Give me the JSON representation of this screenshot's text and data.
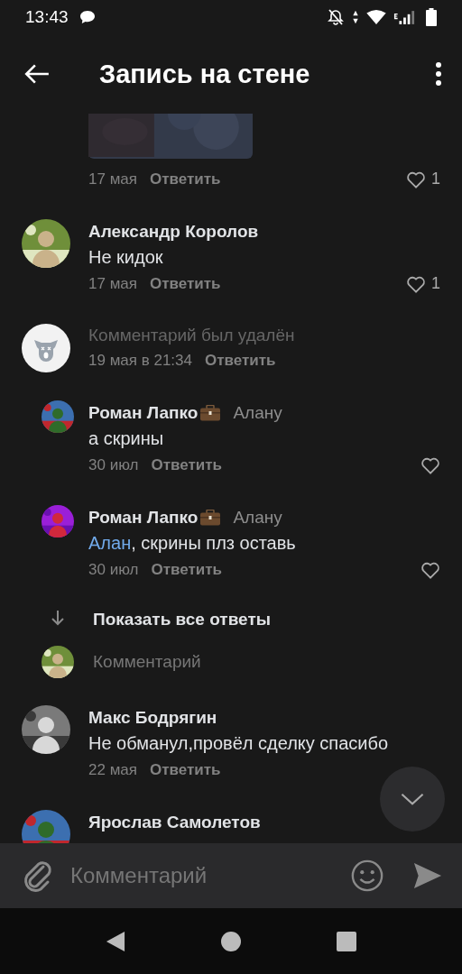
{
  "status_bar": {
    "time": "13:43"
  },
  "header": {
    "title": "Запись на стене"
  },
  "comments": [
    {
      "kind": "attachment",
      "date": "17 мая",
      "reply": "Ответить",
      "likes": "1",
      "liked": false
    },
    {
      "kind": "comment",
      "author": "Александр Королов",
      "text": "Не кидок",
      "date": "17 мая",
      "reply": "Ответить",
      "likes": "1",
      "liked": false
    },
    {
      "kind": "deleted",
      "text": "Комментарий был удалён",
      "date": "19 мая в 21:34",
      "reply": "Ответить"
    },
    {
      "kind": "reply",
      "author": "Роман Лапко",
      "reply_to": "Алану",
      "text": "а скрины",
      "date": "30 июл",
      "reply": "Ответить",
      "liked": false
    },
    {
      "kind": "reply",
      "author": "Роман Лапко",
      "reply_to": "Алану",
      "mention": "Алан",
      "text": ", скрины плз оставь",
      "date": "30 июл",
      "reply": "Ответить",
      "liked": false
    },
    {
      "kind": "show_more",
      "label": "Показать все ответы"
    },
    {
      "kind": "reply_input",
      "placeholder": "Комментарий"
    },
    {
      "kind": "comment",
      "author": "Макс Бодрягин",
      "text": "Не обманул,провёл сделку спасибо",
      "date": "22 мая",
      "reply": "Ответить"
    },
    {
      "kind": "comment",
      "author": "Ярослав Самолетов"
    }
  ],
  "composer": {
    "placeholder": "Комментарий"
  }
}
